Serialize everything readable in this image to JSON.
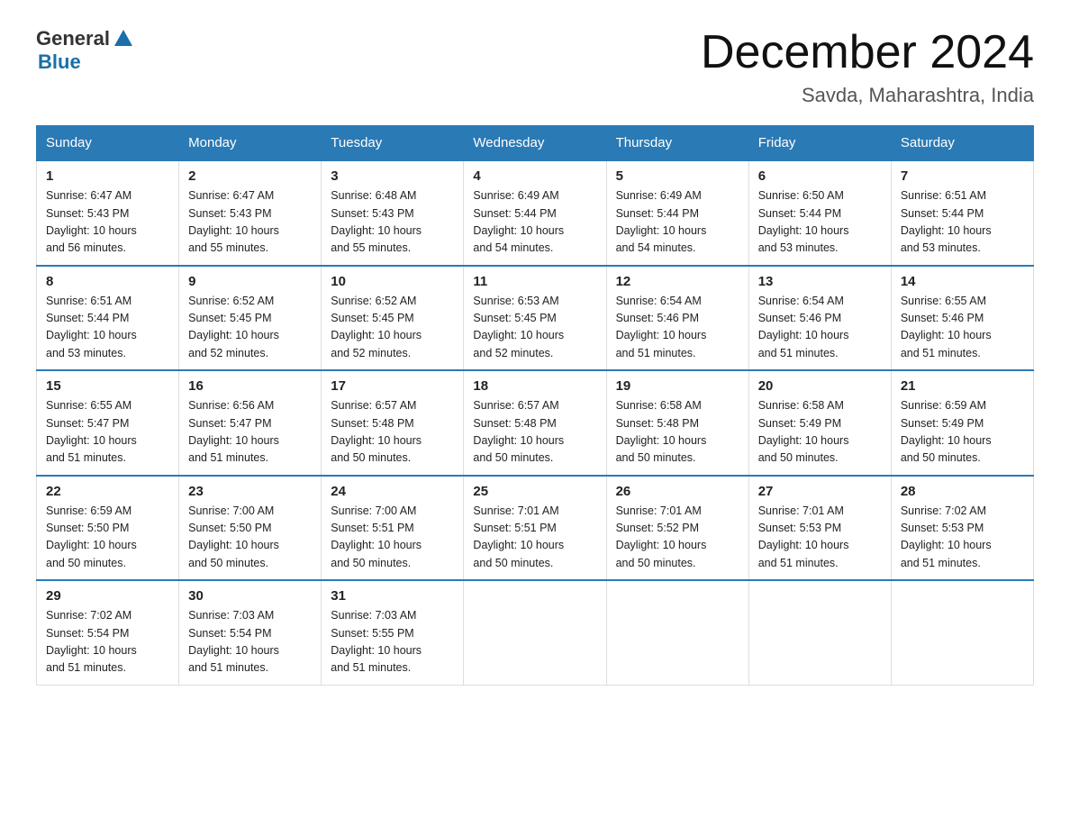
{
  "logo": {
    "general": "General",
    "blue": "Blue",
    "triangle_color": "#1a6fa8"
  },
  "header": {
    "title": "December 2024",
    "subtitle": "Savda, Maharashtra, India"
  },
  "days_of_week": [
    "Sunday",
    "Monday",
    "Tuesday",
    "Wednesday",
    "Thursday",
    "Friday",
    "Saturday"
  ],
  "weeks": [
    [
      {
        "day": "1",
        "sunrise": "6:47 AM",
        "sunset": "5:43 PM",
        "daylight": "10 hours and 56 minutes."
      },
      {
        "day": "2",
        "sunrise": "6:47 AM",
        "sunset": "5:43 PM",
        "daylight": "10 hours and 55 minutes."
      },
      {
        "day": "3",
        "sunrise": "6:48 AM",
        "sunset": "5:43 PM",
        "daylight": "10 hours and 55 minutes."
      },
      {
        "day": "4",
        "sunrise": "6:49 AM",
        "sunset": "5:44 PM",
        "daylight": "10 hours and 54 minutes."
      },
      {
        "day": "5",
        "sunrise": "6:49 AM",
        "sunset": "5:44 PM",
        "daylight": "10 hours and 54 minutes."
      },
      {
        "day": "6",
        "sunrise": "6:50 AM",
        "sunset": "5:44 PM",
        "daylight": "10 hours and 53 minutes."
      },
      {
        "day": "7",
        "sunrise": "6:51 AM",
        "sunset": "5:44 PM",
        "daylight": "10 hours and 53 minutes."
      }
    ],
    [
      {
        "day": "8",
        "sunrise": "6:51 AM",
        "sunset": "5:44 PM",
        "daylight": "10 hours and 53 minutes."
      },
      {
        "day": "9",
        "sunrise": "6:52 AM",
        "sunset": "5:45 PM",
        "daylight": "10 hours and 52 minutes."
      },
      {
        "day": "10",
        "sunrise": "6:52 AM",
        "sunset": "5:45 PM",
        "daylight": "10 hours and 52 minutes."
      },
      {
        "day": "11",
        "sunrise": "6:53 AM",
        "sunset": "5:45 PM",
        "daylight": "10 hours and 52 minutes."
      },
      {
        "day": "12",
        "sunrise": "6:54 AM",
        "sunset": "5:46 PM",
        "daylight": "10 hours and 51 minutes."
      },
      {
        "day": "13",
        "sunrise": "6:54 AM",
        "sunset": "5:46 PM",
        "daylight": "10 hours and 51 minutes."
      },
      {
        "day": "14",
        "sunrise": "6:55 AM",
        "sunset": "5:46 PM",
        "daylight": "10 hours and 51 minutes."
      }
    ],
    [
      {
        "day": "15",
        "sunrise": "6:55 AM",
        "sunset": "5:47 PM",
        "daylight": "10 hours and 51 minutes."
      },
      {
        "day": "16",
        "sunrise": "6:56 AM",
        "sunset": "5:47 PM",
        "daylight": "10 hours and 51 minutes."
      },
      {
        "day": "17",
        "sunrise": "6:57 AM",
        "sunset": "5:48 PM",
        "daylight": "10 hours and 50 minutes."
      },
      {
        "day": "18",
        "sunrise": "6:57 AM",
        "sunset": "5:48 PM",
        "daylight": "10 hours and 50 minutes."
      },
      {
        "day": "19",
        "sunrise": "6:58 AM",
        "sunset": "5:48 PM",
        "daylight": "10 hours and 50 minutes."
      },
      {
        "day": "20",
        "sunrise": "6:58 AM",
        "sunset": "5:49 PM",
        "daylight": "10 hours and 50 minutes."
      },
      {
        "day": "21",
        "sunrise": "6:59 AM",
        "sunset": "5:49 PM",
        "daylight": "10 hours and 50 minutes."
      }
    ],
    [
      {
        "day": "22",
        "sunrise": "6:59 AM",
        "sunset": "5:50 PM",
        "daylight": "10 hours and 50 minutes."
      },
      {
        "day": "23",
        "sunrise": "7:00 AM",
        "sunset": "5:50 PM",
        "daylight": "10 hours and 50 minutes."
      },
      {
        "day": "24",
        "sunrise": "7:00 AM",
        "sunset": "5:51 PM",
        "daylight": "10 hours and 50 minutes."
      },
      {
        "day": "25",
        "sunrise": "7:01 AM",
        "sunset": "5:51 PM",
        "daylight": "10 hours and 50 minutes."
      },
      {
        "day": "26",
        "sunrise": "7:01 AM",
        "sunset": "5:52 PM",
        "daylight": "10 hours and 50 minutes."
      },
      {
        "day": "27",
        "sunrise": "7:01 AM",
        "sunset": "5:53 PM",
        "daylight": "10 hours and 51 minutes."
      },
      {
        "day": "28",
        "sunrise": "7:02 AM",
        "sunset": "5:53 PM",
        "daylight": "10 hours and 51 minutes."
      }
    ],
    [
      {
        "day": "29",
        "sunrise": "7:02 AM",
        "sunset": "5:54 PM",
        "daylight": "10 hours and 51 minutes."
      },
      {
        "day": "30",
        "sunrise": "7:03 AM",
        "sunset": "5:54 PM",
        "daylight": "10 hours and 51 minutes."
      },
      {
        "day": "31",
        "sunrise": "7:03 AM",
        "sunset": "5:55 PM",
        "daylight": "10 hours and 51 minutes."
      },
      null,
      null,
      null,
      null
    ]
  ],
  "labels": {
    "sunrise": "Sunrise:",
    "sunset": "Sunset:",
    "daylight": "Daylight:"
  }
}
